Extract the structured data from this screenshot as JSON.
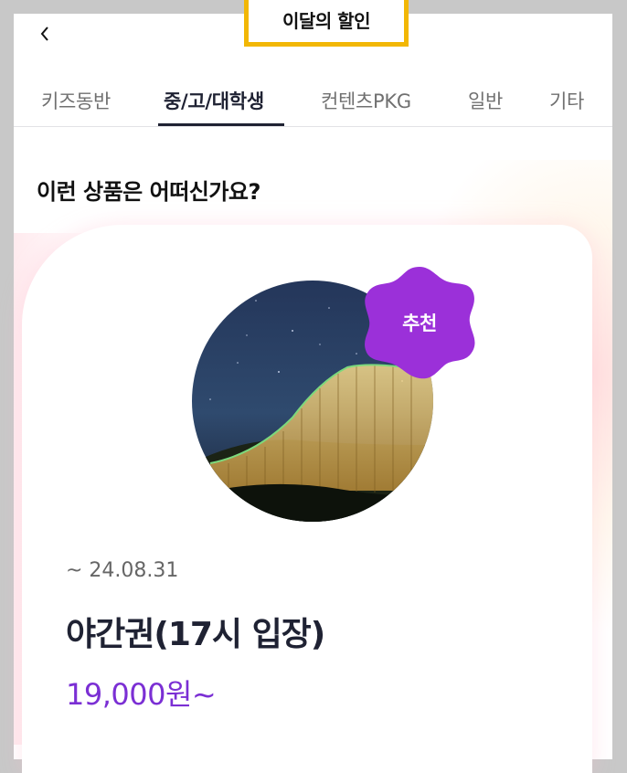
{
  "header": {
    "title": "이달의 할인",
    "back_icon": "chevron-left-icon"
  },
  "tabs": [
    {
      "label": "키즈동반",
      "active": false
    },
    {
      "label": "중/고/대학생",
      "active": true
    },
    {
      "label": "컨텐츠PKG",
      "active": false
    },
    {
      "label": "일반",
      "active": false
    },
    {
      "label": "기타",
      "active": false
    }
  ],
  "section": {
    "title": "이런 상품은 어떠신가요?"
  },
  "product": {
    "badge": "추천",
    "date": "~ 24.08.31",
    "name": "야간권(17시 입장)",
    "price": "19,000원~",
    "image_icon": "night-roller-coaster-photo"
  },
  "colors": {
    "accent": "#7b2fd4",
    "badge": "#9b30d9",
    "highlight": "#f2b705",
    "text": "#1f2233"
  }
}
